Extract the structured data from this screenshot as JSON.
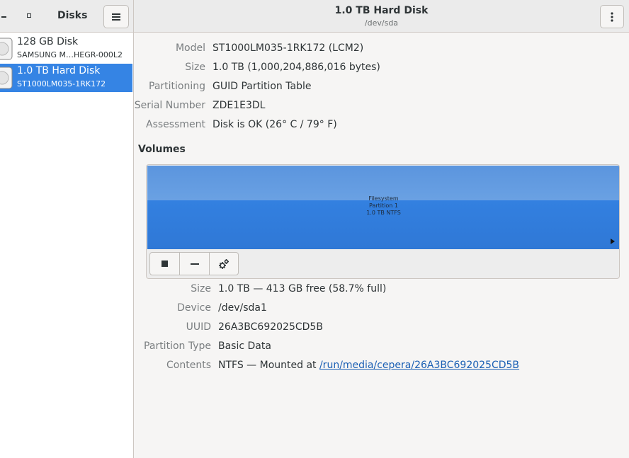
{
  "sidebar": {
    "title": "Disks",
    "disks": [
      {
        "name": "128 GB Disk",
        "model": "SAMSUNG M…HEGR-000L2",
        "selected": false
      },
      {
        "name": "1.0 TB Hard Disk",
        "model": "ST1000LM035-1RK172",
        "selected": true
      }
    ]
  },
  "header": {
    "title": "1.0 TB Hard Disk",
    "subtitle": "/dev/sda"
  },
  "drive": {
    "properties": [
      {
        "label": "Model",
        "value": "ST1000LM035-1RK172 (LCM2)"
      },
      {
        "label": "Size",
        "value": "1.0 TB (1,000,204,886,016 bytes)"
      },
      {
        "label": "Partitioning",
        "value": "GUID Partition Table"
      },
      {
        "label": "Serial Number",
        "value": "ZDE1E3DL"
      },
      {
        "label": "Assessment",
        "value": "Disk is OK (26° C / 79° F)"
      }
    ]
  },
  "volumes": {
    "heading": "Volumes",
    "partition": {
      "line1": "Filesystem",
      "line2": "Partition 1",
      "line3": "1.0 TB NTFS",
      "usage_fraction": 0.587
    },
    "toolbar": {
      "unmount_icon": "stop-icon",
      "delete_icon": "minus-icon",
      "settings_icon": "gears-icon"
    },
    "properties": [
      {
        "label": "Size",
        "value": "1.0 TB — 413 GB free (58.7% full)"
      },
      {
        "label": "Device",
        "value": "/dev/sda1"
      },
      {
        "label": "UUID",
        "value": "26A3BC692025CD5B"
      },
      {
        "label": "Partition Type",
        "value": "Basic Data"
      }
    ],
    "contents": {
      "label": "Contents",
      "prefix": "NTFS — Mounted at ",
      "link": "/run/media/cepera/26A3BC692025CD5B"
    }
  },
  "colors": {
    "accent": "#3584e4",
    "link": "#1a5fb4",
    "partition_used": "#3380e0",
    "partition_top": "#6aa1e3"
  }
}
